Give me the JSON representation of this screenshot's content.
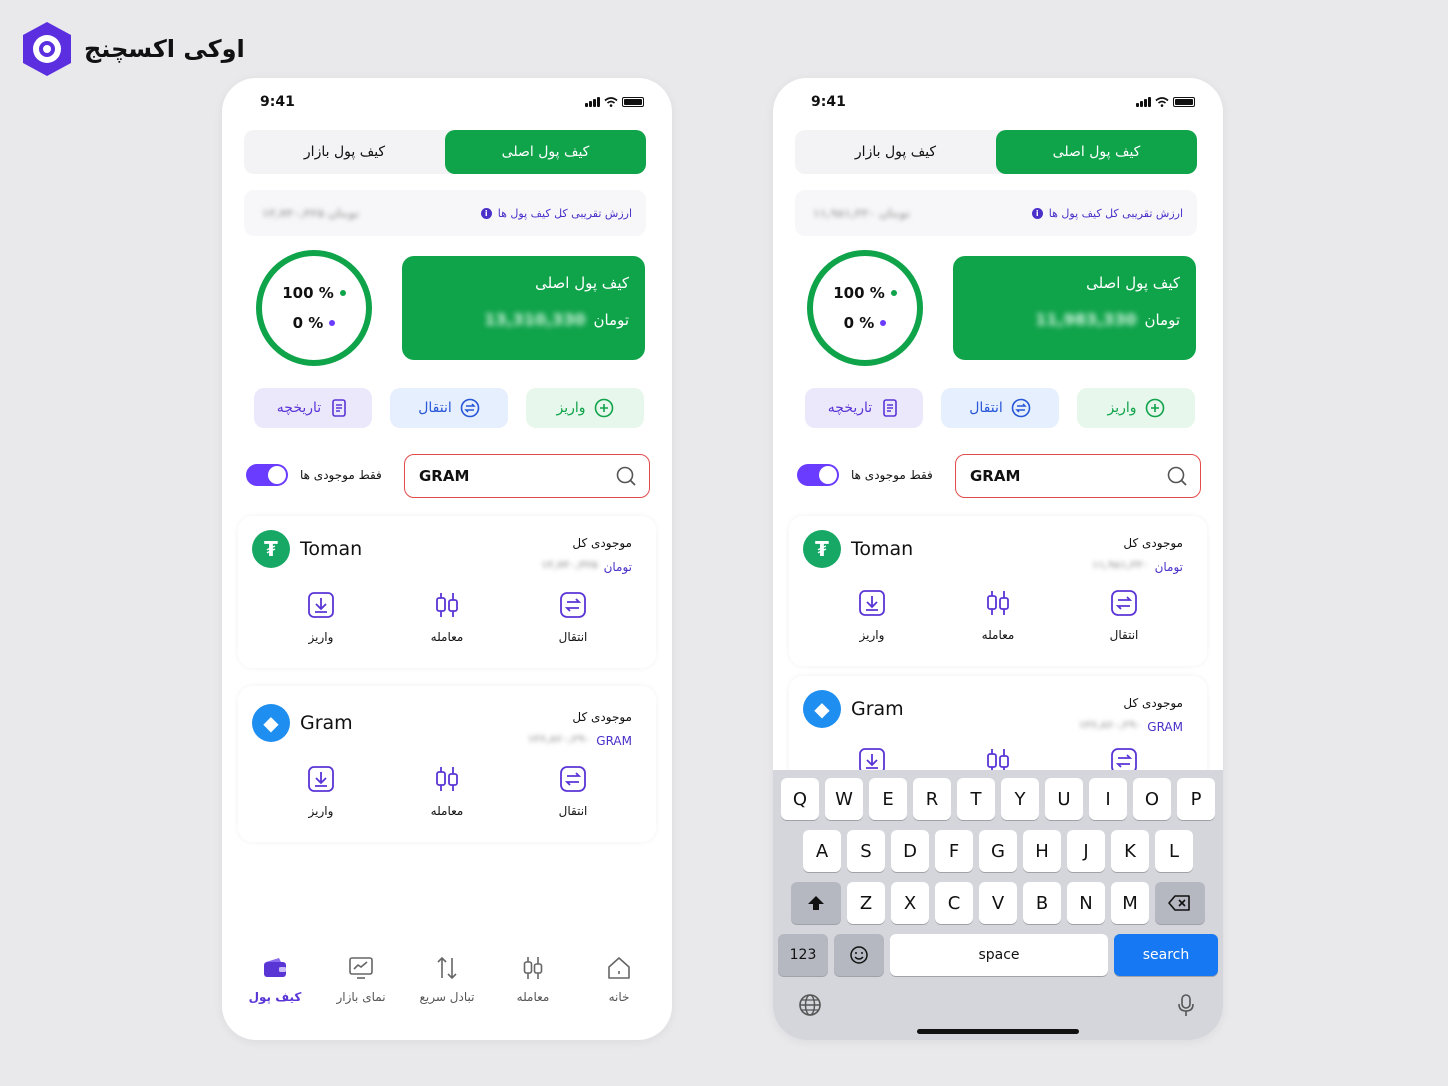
{
  "brand": {
    "name": "اوکی اکسچنج"
  },
  "phones": [
    {
      "time": "9:41",
      "tabs": {
        "market_wallet": "کیف پول بازار",
        "main_wallet": "کیف پول اصلی"
      },
      "estimate_label": "ارزش تقریبی کل کیف پول ها",
      "estimate_value": "۱۳,۷۴۰,۴۲۵ تومان",
      "ring": {
        "green_pct": "100 %",
        "purple_pct": "0 %"
      },
      "card": {
        "title": "کیف پول اصلی",
        "currency": "تومان",
        "amount": "13,310,330"
      },
      "actions": {
        "deposit": "واریز",
        "transfer": "انتقال",
        "history": "تاریخچه"
      },
      "toggle_label": "فقط موجودی ها",
      "search_value": "GRAM",
      "assets": [
        {
          "name": "Toman",
          "balance_label": "موجودی کل",
          "unit": "تومان",
          "amount": "۱۳,۷۴۰,۴۲۵"
        },
        {
          "name": "Gram",
          "balance_label": "موجودی کل",
          "unit": "GRAM",
          "amount": "۱۳۶,۸۶۰,۲۹۰"
        }
      ],
      "ops": {
        "deposit": "واریز",
        "trade": "معامله",
        "transfer": "انتقال"
      },
      "nav": {
        "wallet": "کیف پول",
        "market": "نمای بازار",
        "swap": "تبادل سریع",
        "trade": "معامله",
        "home": "خانه"
      }
    },
    {
      "time": "9:41",
      "tabs": {
        "market_wallet": "کیف پول بازار",
        "main_wallet": "کیف پول اصلی"
      },
      "estimate_label": "ارزش تقریبی کل کیف پول ها",
      "estimate_value": "۱۱,۹۸۱,۳۳۰ تومان",
      "ring": {
        "green_pct": "100 %",
        "purple_pct": "0 %"
      },
      "card": {
        "title": "کیف پول اصلی",
        "currency": "تومان",
        "amount": "11,983,330"
      },
      "actions": {
        "deposit": "واریز",
        "transfer": "انتقال",
        "history": "تاریخچه"
      },
      "toggle_label": "فقط موجودی ها",
      "search_value": "GRAM",
      "assets": [
        {
          "name": "Toman",
          "balance_label": "موجودی کل",
          "unit": "تومان",
          "amount": "۱۱,۹۸۱,۳۳۰"
        },
        {
          "name": "Gram",
          "balance_label": "موجودی کل",
          "unit": "GRAM",
          "amount": "۱۳۶,۸۶۰,۲۹۰"
        }
      ],
      "ops": {
        "deposit": "واریز",
        "trade": "معامله",
        "transfer": "انتقال"
      }
    }
  ],
  "keyboard": {
    "row1": [
      "Q",
      "W",
      "E",
      "R",
      "T",
      "Y",
      "U",
      "I",
      "O",
      "P"
    ],
    "row2": [
      "A",
      "S",
      "D",
      "F",
      "G",
      "H",
      "J",
      "K",
      "L"
    ],
    "row3": [
      "Z",
      "X",
      "C",
      "V",
      "B",
      "N",
      "M"
    ],
    "numbers": "123",
    "space": "space",
    "go": "search"
  },
  "colors": {
    "green": "#0fa34a",
    "purple": "#6a3cff",
    "blue": "#2856d8",
    "search_border": "#e24b4b"
  }
}
